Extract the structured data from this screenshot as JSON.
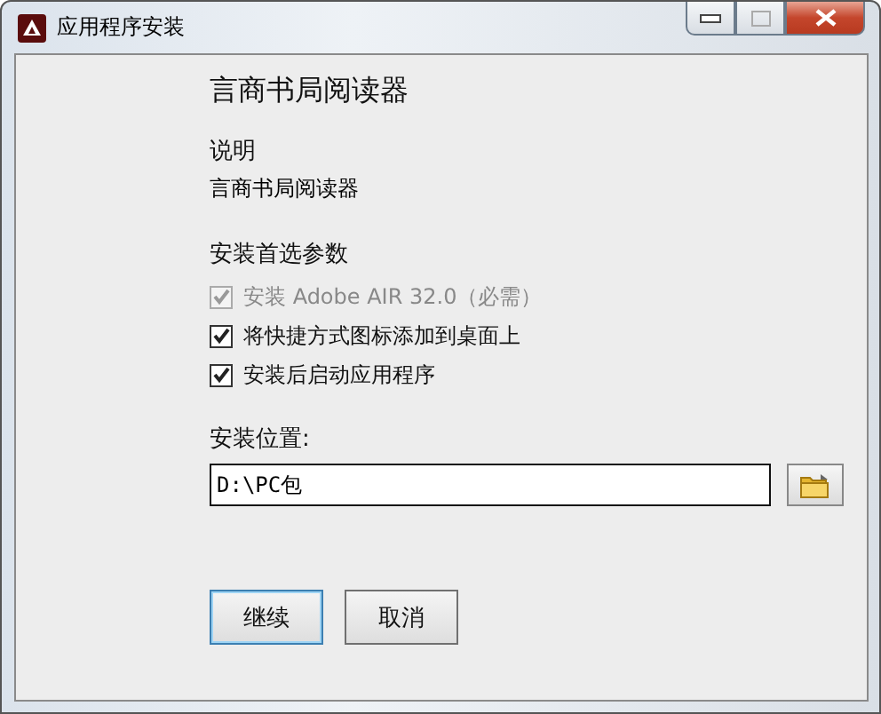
{
  "window": {
    "title": "应用程序安装"
  },
  "app_name": "言商书局阅读器",
  "description": {
    "heading": "说明",
    "text": "言商书局阅读器"
  },
  "preferences": {
    "heading": "安装首选参数",
    "options": [
      {
        "label": "安装 Adobe AIR 32.0（必需）",
        "checked": true,
        "disabled": true
      },
      {
        "label": "将快捷方式图标添加到桌面上",
        "checked": true,
        "disabled": false
      },
      {
        "label": "安装后启动应用程序",
        "checked": true,
        "disabled": false
      }
    ]
  },
  "location": {
    "label": "安装位置:",
    "value": "D:\\PC包"
  },
  "buttons": [
    {
      "label": "继续",
      "selected": true
    },
    {
      "label": "取消",
      "selected": false
    }
  ]
}
